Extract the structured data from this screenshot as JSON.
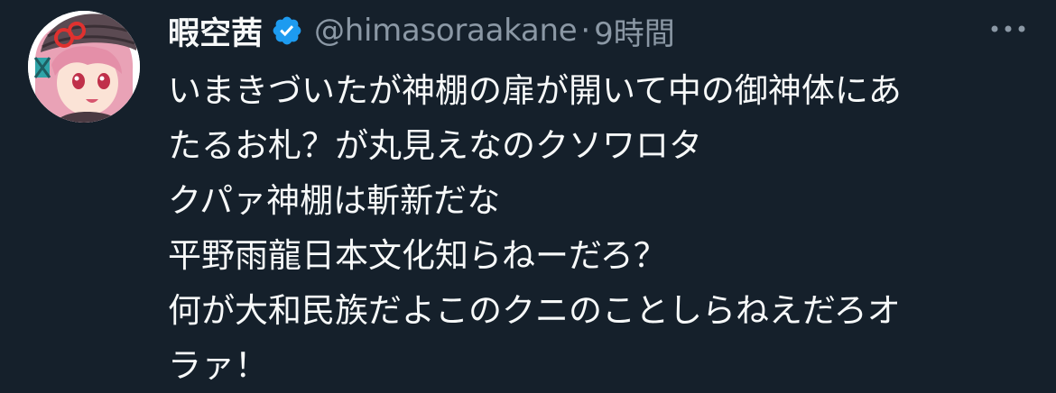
{
  "tweet": {
    "display_name": "暇空茜",
    "verified": true,
    "handle": "@himasoraakane",
    "separator": "·",
    "timestamp": "9時間",
    "more_icon": "ellipsis-icon",
    "text_lines": [
      "いまきづいたが神棚の扉が開いて中の御神体にあ",
      "たるお札？が丸見えなのクソワロタ",
      "クパァ神棚は斬新だな",
      "平野雨龍日本文化知らねーだろ？",
      "何が大和民族だよこのクニのことしらねえだろオ",
      "ラァ！"
    ]
  },
  "colors": {
    "background": "#15202b",
    "primary_text": "#f7f9f9",
    "secondary_text": "#8b98a5",
    "verified_badge": "#1d9bf0"
  }
}
